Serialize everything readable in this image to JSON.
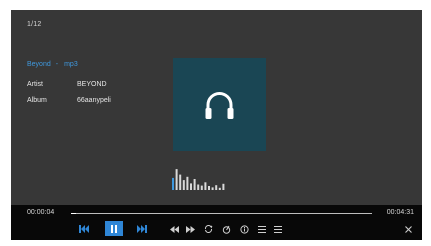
{
  "player": {
    "track_counter": "1/12",
    "track": {
      "title": "Beyond",
      "separator": "-",
      "format": "mp3"
    },
    "metadata": {
      "artist_label": "Artist",
      "artist_value": "BEYOND",
      "album_label": "Album",
      "album_value": "66aanypeli"
    },
    "album_art_icon": "headphones-icon",
    "equalizer_levels": [
      0.55,
      0.95,
      0.7,
      0.45,
      0.6,
      0.3,
      0.5,
      0.25,
      0.2,
      0.35,
      0.18,
      0.12,
      0.22,
      0.1,
      0.28
    ],
    "colors": {
      "accent": "#2f86d6",
      "title_blue": "#3f98dd",
      "art_background": "#1a4654",
      "screen_background": "#373737",
      "control_bar": "#080808"
    }
  },
  "controls": {
    "current_time": "00:00:04",
    "total_time": "00:04:31",
    "progress_fraction": 0.015,
    "buttons": [
      {
        "name": "previous-track-button",
        "icon": "skip-previous-icon"
      },
      {
        "name": "pause-button",
        "icon": "pause-icon"
      },
      {
        "name": "next-track-button",
        "icon": "skip-next-icon"
      },
      {
        "name": "rewind-button",
        "icon": "rewind-icon"
      },
      {
        "name": "fast-forward-button",
        "icon": "fast-forward-icon"
      },
      {
        "name": "repeat-button",
        "icon": "repeat-icon"
      },
      {
        "name": "shuffle-button",
        "icon": "shuffle-icon"
      },
      {
        "name": "info-button",
        "icon": "info-icon"
      },
      {
        "name": "playlist-button",
        "icon": "list-icon"
      },
      {
        "name": "menu-button",
        "icon": "menu-icon"
      },
      {
        "name": "close-button",
        "icon": "close-icon"
      }
    ]
  }
}
